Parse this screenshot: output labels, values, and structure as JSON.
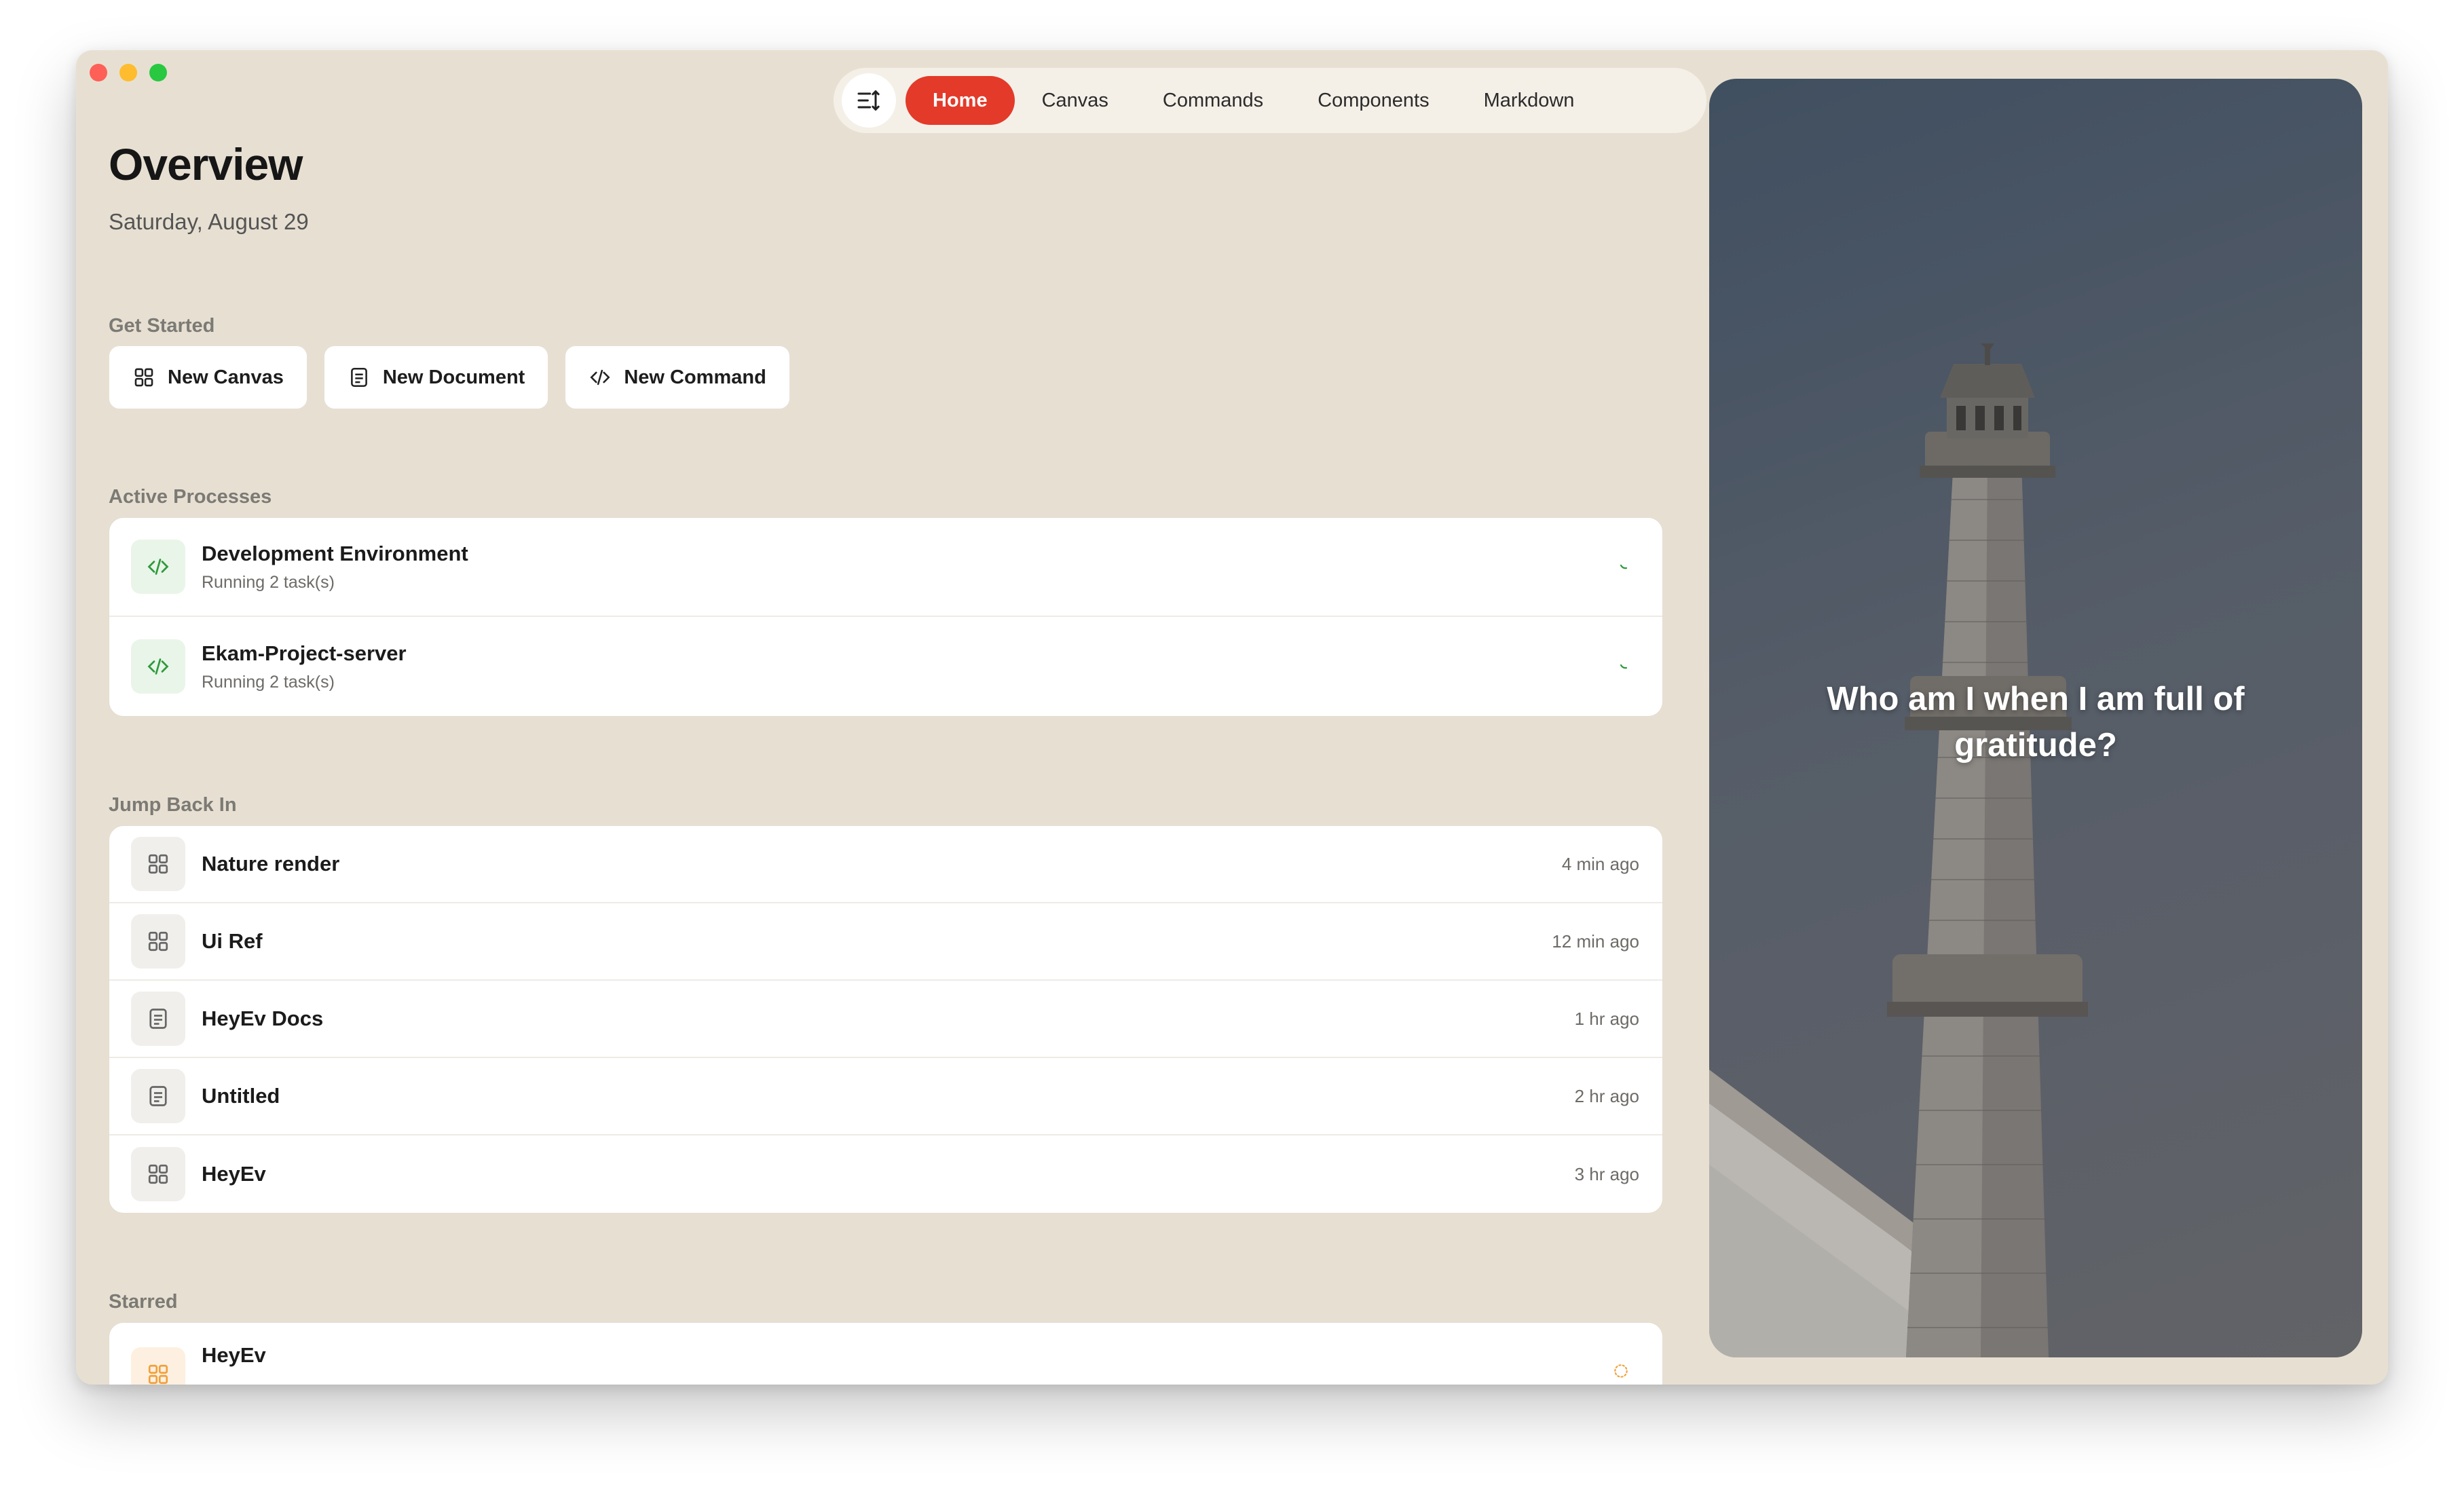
{
  "window": {
    "controls": [
      "close",
      "minimize",
      "maximize"
    ]
  },
  "nav": {
    "toggle_icon": "sort-toggle-icon",
    "tabs": [
      {
        "label": "Home",
        "active": true
      },
      {
        "label": "Canvas",
        "active": false
      },
      {
        "label": "Commands",
        "active": false
      },
      {
        "label": "Components",
        "active": false
      },
      {
        "label": "Markdown",
        "active": false
      }
    ]
  },
  "overview": {
    "title": "Overview",
    "date": "Saturday, August 29"
  },
  "get_started": {
    "label": "Get Started",
    "buttons": [
      {
        "label": "New Canvas",
        "icon": "grid-icon"
      },
      {
        "label": "New Document",
        "icon": "document-icon"
      },
      {
        "label": "New Command",
        "icon": "code-icon"
      }
    ]
  },
  "active_processes": {
    "label": "Active Processes",
    "items": [
      {
        "name": "Development Environment",
        "status": "Running 2 task(s)",
        "icon": "code-icon"
      },
      {
        "name": "Ekam-Project-server",
        "status": "Running 2 task(s)",
        "icon": "code-icon"
      }
    ]
  },
  "jump_back_in": {
    "label": "Jump Back In",
    "items": [
      {
        "name": "Nature render",
        "time": "4 min ago",
        "icon": "grid-icon"
      },
      {
        "name": "Ui Ref",
        "time": "12 min ago",
        "icon": "grid-icon"
      },
      {
        "name": "HeyEv Docs",
        "time": "1 hr ago",
        "icon": "document-icon"
      },
      {
        "name": "Untitled",
        "time": "2 hr ago",
        "icon": "document-icon"
      },
      {
        "name": "HeyEv",
        "time": "3 hr ago",
        "icon": "grid-icon"
      }
    ]
  },
  "starred": {
    "label": "Starred",
    "items": [
      {
        "name": "HeyEv",
        "icon": "grid-icon"
      }
    ]
  },
  "hero": {
    "quote": "Who am I when I am full of gratitude?"
  },
  "colors": {
    "background": "#e7e0d2",
    "accent": "#e33a2a",
    "process_green": "#2e9a3c",
    "starred_orange": "#f0a13c"
  }
}
